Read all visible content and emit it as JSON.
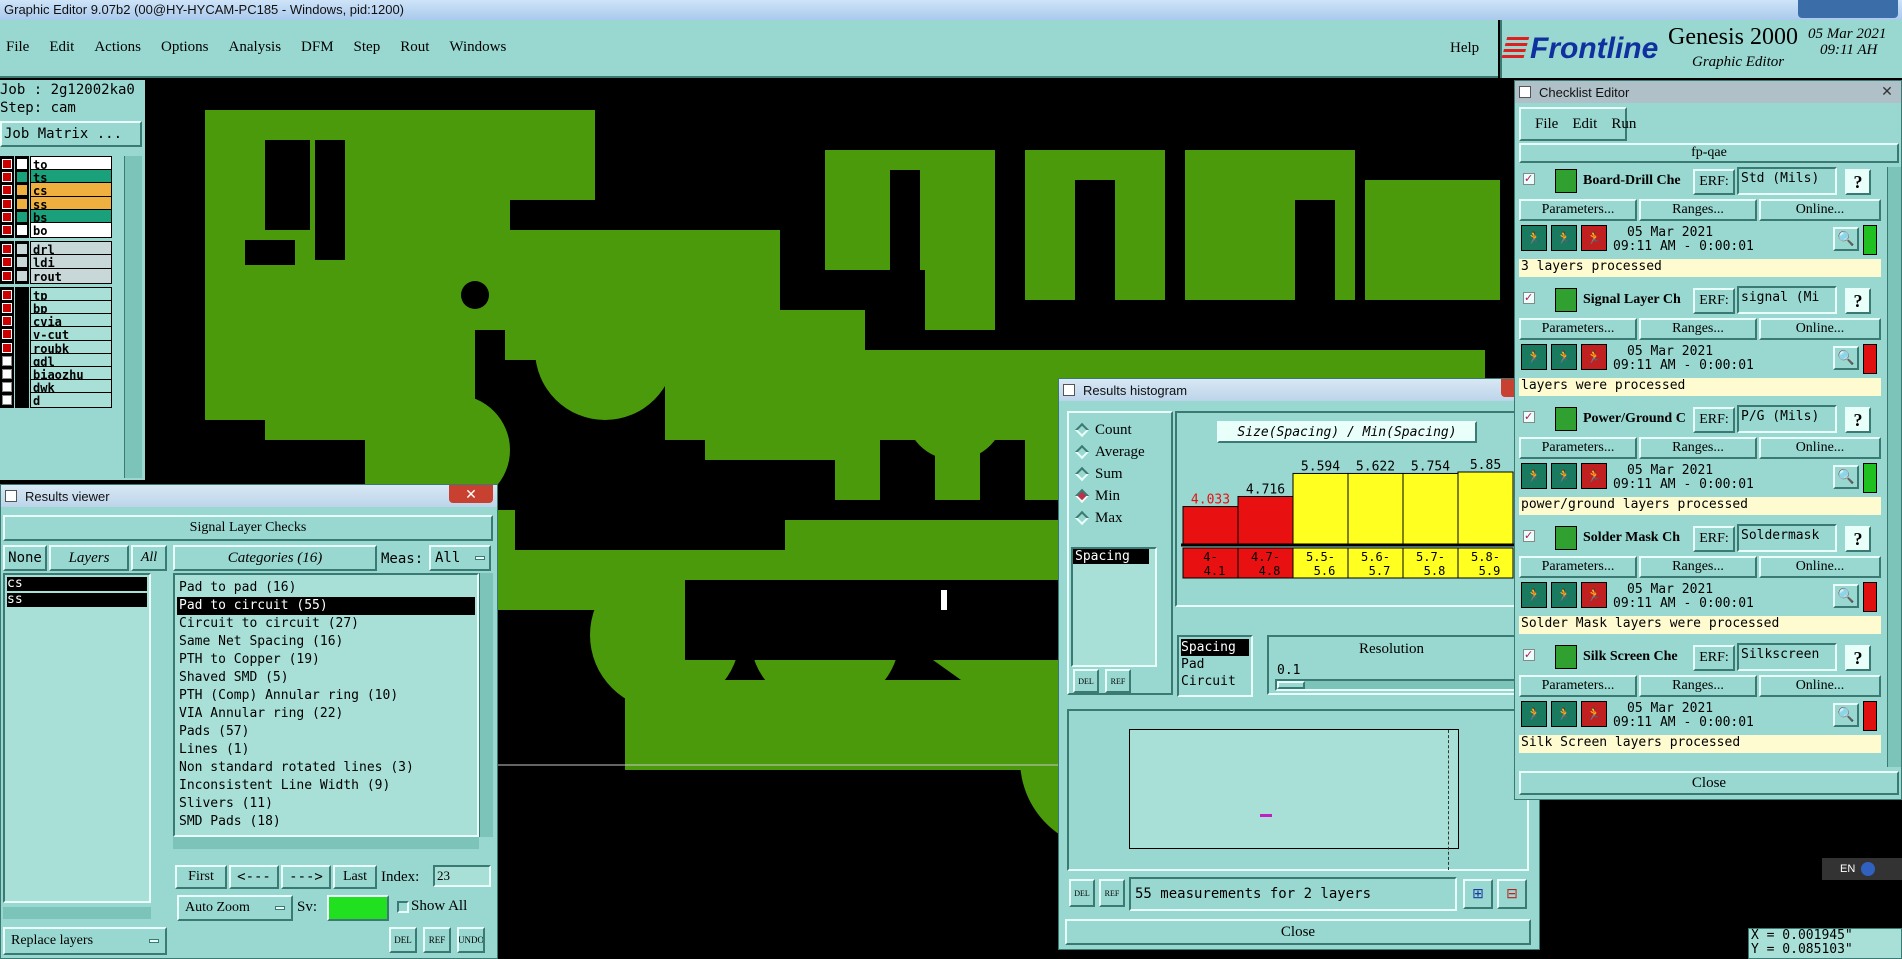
{
  "window_title": "Graphic Editor 9.07b2 (00@HY-HYCAM-PC185 - Windows, pid:1200)",
  "menu": [
    "File",
    "Edit",
    "Actions",
    "Options",
    "Analysis",
    "DFM",
    "Step",
    "Rout",
    "Windows"
  ],
  "help": "Help",
  "brand": {
    "logo": "Frontline",
    "product": "Genesis 2000",
    "subtitle": "Graphic Editor",
    "date": "05 Mar 2021",
    "time": "09:11 AH"
  },
  "job": {
    "job": "Job : 2g12002ka0",
    "step": "Step: cam",
    "matrix": "Job Matrix ..."
  },
  "layers": [
    "to",
    "ts",
    "cs",
    "ss",
    "bs",
    "bo",
    "drl",
    "ldi",
    "rout",
    "tp",
    "bp",
    "cvia",
    "v-cut",
    "roubk",
    "gdl",
    "biaozhu",
    "dwk",
    "d"
  ],
  "layer_colors": {
    "to": "#ffffff",
    "ts": "#1aa07a",
    "cs": "#f0b040",
    "ss": "#f0b040",
    "bs": "#1aa07a",
    "bo": "#ffffff",
    "drl": "#c8d8d8",
    "ldi": "#c8d8d8",
    "rout": "#c8d8d8"
  },
  "results_viewer": {
    "title": "Results viewer",
    "header": "Signal Layer Checks",
    "none": "None",
    "layers": "Layers",
    "all": "All",
    "layer_list": [
      "cs",
      "ss"
    ],
    "categories_label": "Categories (16)",
    "meas_label": "Meas:",
    "meas_value": "All",
    "categories": [
      "Pad to pad (16)",
      "Pad to circuit (55)",
      "Circuit to circuit (27)",
      "Same Net Spacing (16)",
      "PTH to Copper (19)",
      "Shaved SMD (5)",
      "PTH (Comp) Annular ring (10)",
      "VIA Annular ring (22)",
      "Pads (57)",
      "Lines (1)",
      "Non standard rotated lines (3)",
      "Inconsistent Line Width (9)",
      "Slivers (11)",
      "SMD Pads (18)"
    ],
    "selected_category": 1,
    "nav": {
      "first": "First",
      "prev": "<---",
      "next": "--->",
      "last": "Last",
      "index_label": "Index:",
      "index_value": "23"
    },
    "auto_zoom": "Auto Zoom",
    "sv": "Sv:",
    "show_all": "Show All",
    "replace_layers": "Replace layers",
    "icons": [
      "DEL",
      "REF",
      "UNDO"
    ]
  },
  "histogram": {
    "title": "Results histogram",
    "options": [
      "Count",
      "Average",
      "Sum",
      "Min",
      "Max"
    ],
    "selected_option": "Min",
    "list_item": "Spacing",
    "heading": "Size(Spacing) / Min(Spacing)",
    "bars": [
      {
        "value": "4.033",
        "range": "4-4.1",
        "height": 0.52,
        "color": "#e81010",
        "text": "#e81010"
      },
      {
        "value": "4.716",
        "range": "4.7-4.8",
        "height": 0.66,
        "color": "#e81010",
        "text": "#000"
      },
      {
        "value": "5.594",
        "range": "5.5-5.6",
        "height": 0.98,
        "color": "#ffff20",
        "text": "#000"
      },
      {
        "value": "5.622",
        "range": "5.6-5.7",
        "height": 0.98,
        "color": "#ffff20",
        "text": "#000"
      },
      {
        "value": "5.754",
        "range": "5.7-5.8",
        "height": 0.98,
        "color": "#ffff20",
        "text": "#000"
      },
      {
        "value": "5.85",
        "range": "5.8-5.9",
        "height": 1.0,
        "color": "#ffff20",
        "text": "#000"
      }
    ],
    "types": [
      "Spacing",
      "Pad",
      "Circuit"
    ],
    "resolution_label": "Resolution",
    "resolution_value": "0.1",
    "status": "55 measurements for 2 layers",
    "close": "Close",
    "icons": [
      "DEL",
      "REF"
    ]
  },
  "checklist": {
    "title": "Checklist Editor",
    "menu": [
      "File",
      "Edit",
      "Run"
    ],
    "name": "fp-qae",
    "erf": "ERF:",
    "params": "Parameters...",
    "ranges": "Ranges...",
    "online": "Online...",
    "items": [
      {
        "name": "Board-Drill Che",
        "erf": "Std (Mils)",
        "date": "05 Mar 2021",
        "time": "09:11 AM - 0:00:01",
        "status": "3 layers processed",
        "flag": "#20c020"
      },
      {
        "name": "Signal Layer Ch",
        "erf": "signal (Mi",
        "date": "05 Mar 2021",
        "time": "09:11 AM - 0:00:01",
        "status": "layers were processed",
        "flag": "#e01010"
      },
      {
        "name": "Power/Ground C",
        "erf": "P/G (Mils)",
        "date": "05 Mar 2021",
        "time": "09:11 AM - 0:00:01",
        "status": "power/ground layers processed",
        "flag": "#20c020"
      },
      {
        "name": "Solder Mask Ch",
        "erf": "Soldermask",
        "date": "05 Mar 2021",
        "time": "09:11 AM - 0:00:01",
        "status": "Solder Mask layers were processed",
        "flag": "#e01010"
      },
      {
        "name": "Silk Screen Che",
        "erf": "Silkscreen",
        "date": "05 Mar 2021",
        "time": "09:11 AM - 0:00:01",
        "status": "Silk Screen layers processed",
        "flag": "#e01010"
      }
    ],
    "close": "Close"
  },
  "coords": {
    "x": "X = 0.001945\"",
    "y": "Y = 0.085103\""
  },
  "tray": "EN"
}
